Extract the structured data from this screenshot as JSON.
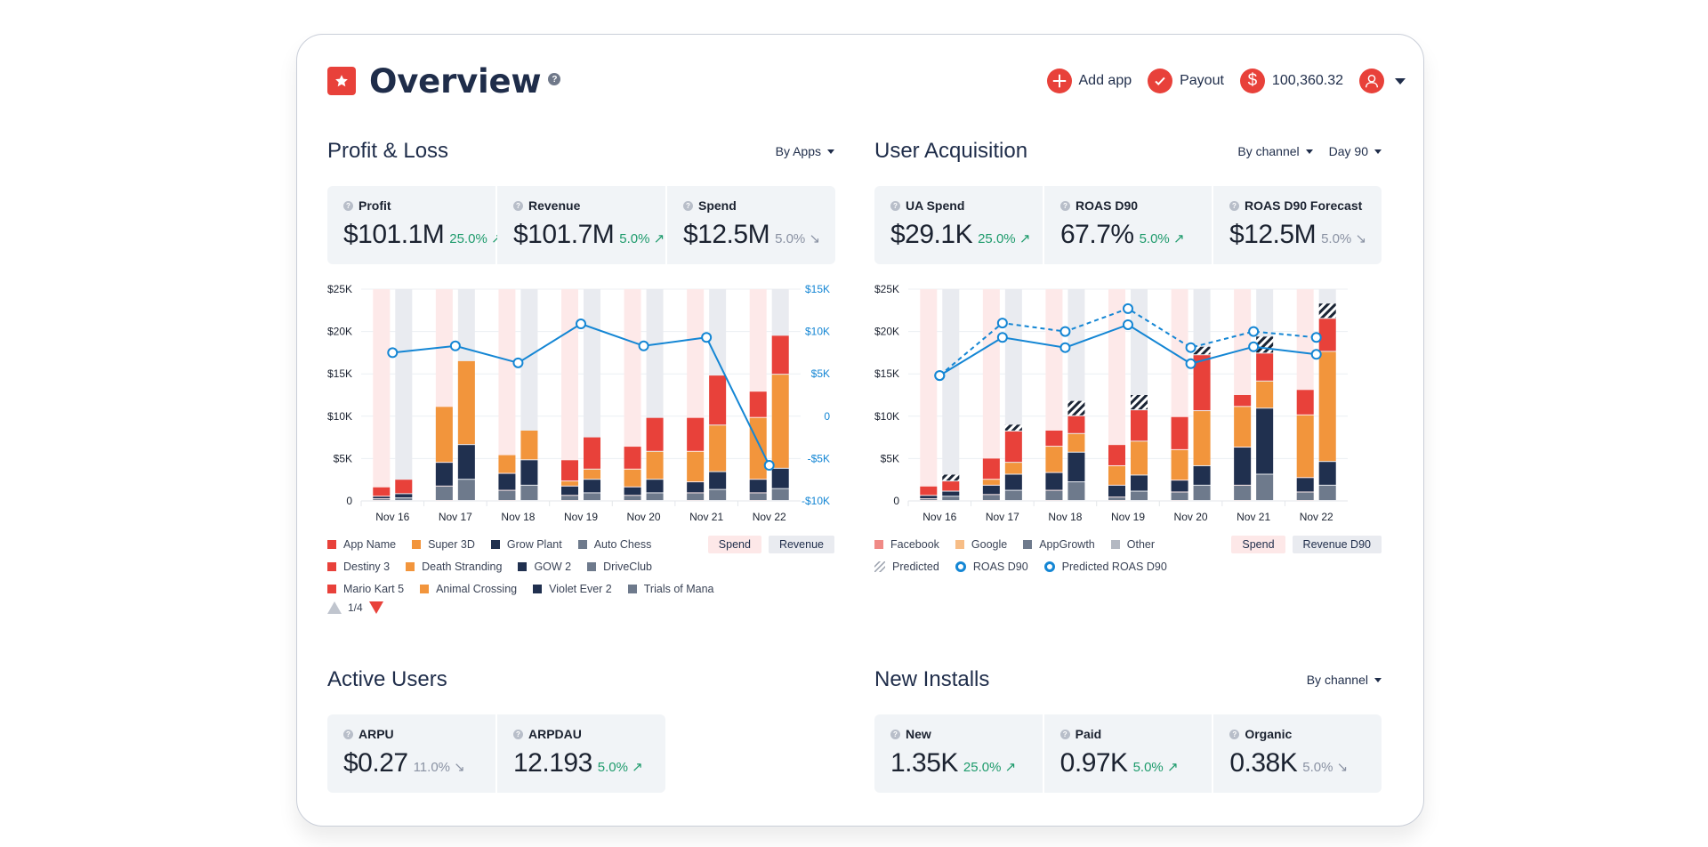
{
  "header": {
    "title": "Overview",
    "help": "?",
    "actions": [
      {
        "label": "Add app",
        "icon": "plus-icon"
      },
      {
        "label": "Payout",
        "icon": "check-icon"
      },
      {
        "label": "100,360.32",
        "icon": "dollar-icon"
      }
    ],
    "user_icon": "user-avatar-icon"
  },
  "profit_loss": {
    "title": "Profit & Loss",
    "controls": [
      "By Apps"
    ],
    "kpis": [
      {
        "label": "Profit",
        "value": "$101.1M",
        "delta": "25.0%",
        "trend": "up",
        "arrow": "↗"
      },
      {
        "label": "Revenue",
        "value": "$101.7M",
        "delta": "5.0%",
        "trend": "up",
        "arrow": "↗"
      },
      {
        "label": "Spend",
        "value": "$12.5M",
        "delta": "5.0%",
        "trend": "down",
        "arrow": "↘"
      }
    ],
    "legend": {
      "rows": [
        [
          {
            "label": "App Name",
            "color": "#e8413a"
          },
          {
            "label": "Super 3D",
            "color": "#f2953c"
          },
          {
            "label": "Grow Plant",
            "color": "#20304f"
          },
          {
            "label": "Auto Chess",
            "color": "#6e7a8c"
          }
        ],
        [
          {
            "label": "Destiny 3",
            "color": "#e8413a"
          },
          {
            "label": "Death Stranding",
            "color": "#f2953c"
          },
          {
            "label": "GOW 2",
            "color": "#20304f"
          },
          {
            "label": "DriveClub",
            "color": "#6e7a8c"
          }
        ],
        [
          {
            "label": "Mario Kart 5",
            "color": "#e8413a"
          },
          {
            "label": "Animal Crossing",
            "color": "#f2953c"
          },
          {
            "label": "Violet Ever 2",
            "color": "#20304f"
          },
          {
            "label": "Trials of Mana",
            "color": "#6e7a8c"
          }
        ]
      ],
      "spend_label": "Spend",
      "revenue_label": "Revenue",
      "pager": "1/4"
    }
  },
  "user_acquisition": {
    "title": "User Acquisition",
    "controls": [
      "By channel",
      "Day 90"
    ],
    "kpis": [
      {
        "label": "UA Spend",
        "value": "$29.1K",
        "delta": "25.0%",
        "trend": "up",
        "arrow": "↗"
      },
      {
        "label": "ROAS D90",
        "value": "67.7%",
        "delta": "5.0%",
        "trend": "up",
        "arrow": "↗"
      },
      {
        "label": "ROAS D90 Forecast",
        "value": "$12.5M",
        "delta": "5.0%",
        "trend": "down",
        "arrow": "↘"
      }
    ],
    "legend": {
      "row1": [
        {
          "label": "Facebook",
          "color": "#f08a86"
        },
        {
          "label": "Google",
          "color": "#f7bd86"
        },
        {
          "label": "AppGrowth",
          "color": "#6e7a8c"
        },
        {
          "label": "Other",
          "color": "#b3b8c2"
        }
      ],
      "spend_label": "Spend",
      "revenue_label": "Revenue D90",
      "row2": [
        {
          "label": "Predicted"
        },
        {
          "label": "ROAS D90"
        },
        {
          "label": "Predicted ROAS D90"
        }
      ]
    }
  },
  "active_users": {
    "title": "Active Users",
    "kpis": [
      {
        "label": "ARPU",
        "value": "$0.27",
        "delta": "11.0%",
        "trend": "down",
        "arrow": "↘"
      },
      {
        "label": "ARPDAU",
        "value": "12.193",
        "delta": "5.0%",
        "trend": "up",
        "arrow": "↗"
      }
    ]
  },
  "new_installs": {
    "title": "New Installs",
    "controls": [
      "By channel"
    ],
    "kpis": [
      {
        "label": "New",
        "value": "1.35K",
        "delta": "25.0%",
        "trend": "up",
        "arrow": "↗"
      },
      {
        "label": "Paid",
        "value": "0.97K",
        "delta": "5.0%",
        "trend": "up",
        "arrow": "↗"
      },
      {
        "label": "Organic",
        "value": "0.38K",
        "delta": "5.0%",
        "trend": "down",
        "arrow": "↘"
      }
    ]
  },
  "chart_data": [
    {
      "type": "bar",
      "title": "Profit & Loss",
      "categories": [
        "Nov 16",
        "Nov 17",
        "Nov 18",
        "Nov 19",
        "Nov 20",
        "Nov 21",
        "Nov 22"
      ],
      "y_ticks": [
        "0",
        "$5K",
        "$10K",
        "$15K",
        "$20K",
        "$25K"
      ],
      "ylim": [
        0,
        25000
      ],
      "y2_ticks": [
        "-$10K",
        "-$5K",
        "0",
        "$5K",
        "$10K",
        "$15K"
      ],
      "y2lim": [
        -10000,
        15000
      ],
      "stack_colors": [
        "#6e7a8c",
        "#20304f",
        "#f2953c",
        "#e8413a"
      ],
      "spend_stacks": [
        [
          200,
          300,
          0,
          1100
        ],
        [
          1700,
          2800,
          6600,
          0
        ],
        [
          1200,
          2000,
          2200,
          0
        ],
        [
          600,
          1100,
          600,
          2500
        ],
        [
          600,
          1000,
          2100,
          2700
        ],
        [
          900,
          1300,
          3600,
          4000
        ],
        [
          900,
          1600,
          7300,
          3100
        ]
      ],
      "revenue_stacks": [
        [
          300,
          500,
          0,
          1700
        ],
        [
          2500,
          4100,
          9900,
          0
        ],
        [
          1800,
          3000,
          3500,
          0
        ],
        [
          900,
          1600,
          1200,
          3800
        ],
        [
          900,
          1600,
          3300,
          4000
        ],
        [
          1300,
          2100,
          5500,
          5900
        ],
        [
          1400,
          2400,
          11100,
          4600
        ]
      ],
      "series": [
        {
          "name": "Profit",
          "axis": "right",
          "values": [
            7500,
            8300,
            6300,
            10900,
            8300,
            9300,
            -5800
          ]
        }
      ]
    },
    {
      "type": "bar",
      "title": "User Acquisition",
      "categories": [
        "Nov 16",
        "Nov 17",
        "Nov 18",
        "Nov 19",
        "Nov 20",
        "Nov 21",
        "Nov 22"
      ],
      "y_ticks": [
        "0",
        "$5K",
        "$10K",
        "$15K",
        "$20K",
        "$25K"
      ],
      "ylim": [
        0,
        25000
      ],
      "stack_colors": [
        "#6e7a8c",
        "#20304f",
        "#f2953c",
        "#e8413a"
      ],
      "spend_stacks": [
        [
          200,
          400,
          0,
          1100
        ],
        [
          700,
          1100,
          700,
          2500
        ],
        [
          1200,
          2100,
          3100,
          1900
        ],
        [
          400,
          1400,
          2300,
          2500
        ],
        [
          1000,
          1400,
          3600,
          3900
        ],
        [
          1800,
          4500,
          4800,
          1400
        ],
        [
          1000,
          1700,
          7400,
          3000
        ]
      ],
      "revenue_stacks": [
        [
          500,
          600,
          0,
          1200
        ],
        [
          1200,
          1900,
          1400,
          3700
        ],
        [
          2200,
          3500,
          2200,
          2100
        ],
        [
          1100,
          1900,
          4000,
          3700
        ],
        [
          1800,
          2300,
          6500,
          6600
        ],
        [
          3100,
          7800,
          3200,
          3300
        ],
        [
          1800,
          2800,
          13000,
          3900
        ]
      ],
      "predicted": [
        800,
        800,
        1800,
        1800,
        1000,
        2000,
        1800
      ],
      "series": [
        {
          "name": "ROAS D90",
          "values": [
            14800,
            19300,
            18100,
            20800,
            16200,
            18200,
            17300
          ]
        },
        {
          "name": "Predicted ROAS D90",
          "style": "dashed",
          "values": [
            14800,
            21000,
            20000,
            22700,
            18100,
            20000,
            19300
          ]
        }
      ]
    }
  ]
}
